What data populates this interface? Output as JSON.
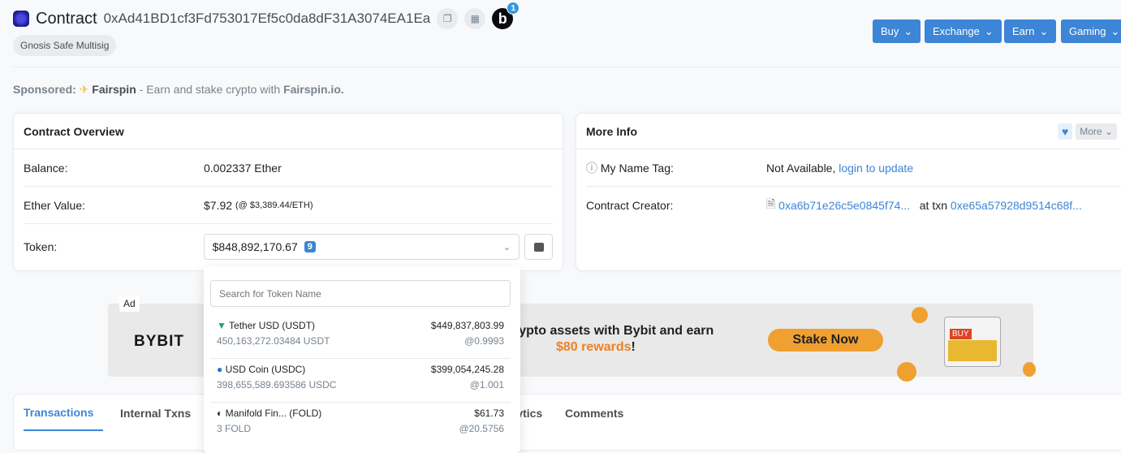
{
  "header": {
    "title": "Contract",
    "address": "0xAd41BD1cf3Fd753017Ef5c0da8dF31A3074EA1Ea",
    "blockscan_badge": "b",
    "notification_count": "1",
    "tag": "Gnosis Safe Multisig"
  },
  "nav_buttons": [
    {
      "label": "Buy"
    },
    {
      "label": "Exchange"
    },
    {
      "label": "Earn"
    },
    {
      "label": "Gaming"
    }
  ],
  "sponsored": {
    "label": "Sponsored:",
    "brand": "Fairspin",
    "text": " - Earn and stake crypto with ",
    "link": "Fairspin.io."
  },
  "overview": {
    "title": "Contract Overview",
    "balance_label": "Balance:",
    "balance": "0.002337 Ether",
    "value_label": "Ether Value:",
    "value": "$7.92",
    "value_rate": "(@ $3,389.44/ETH)",
    "token_label": "Token:",
    "token_total": "$848,892,170.67",
    "token_count": "9"
  },
  "more_info": {
    "title": "More Info",
    "more_label": "More",
    "name_tag_label": "My Name Tag:",
    "name_tag_value": "Not Available,",
    "name_tag_link": "login to update",
    "creator_label": "Contract Creator:",
    "creator_address": "0xa6b71e26c5e0845f74...",
    "at_txn": "at txn",
    "txn_hash": "0xe65a57928d9514c68f..."
  },
  "token_dropdown": {
    "search_placeholder": "Search for Token Name",
    "tokens": [
      {
        "name": "Tether USD (USDT)",
        "value": "$449,837,803.99",
        "amount": "450,163,272.03484 USDT",
        "price": "@0.9993",
        "icon_color": "#26a17b"
      },
      {
        "name": "USD Coin (USDC)",
        "value": "$399,054,245.28",
        "amount": "398,655,589.693586 USDC",
        "price": "@1.001",
        "icon_color": "#2775ca"
      },
      {
        "name": "Manifold Fin... (FOLD)",
        "value": "$61.73",
        "amount": "3 FOLD",
        "price": "@20.5756",
        "icon_color": "#111111"
      }
    ]
  },
  "ad": {
    "tag": "Ad",
    "brand": "BYBIT",
    "text1": "rypto assets with Bybit and earn",
    "text2_highlight": "$80 rewards",
    "text2_end": "!",
    "cta": "Stake Now",
    "art_label": "BUY"
  },
  "tabs": [
    {
      "label": "Transactions",
      "active": true
    },
    {
      "label": "Internal Txns"
    },
    {
      "label": "Analytics"
    },
    {
      "label": "Comments"
    }
  ],
  "colors": {
    "accent": "#3d85d6",
    "cta": "#f0a030",
    "reward": "#f08020"
  }
}
